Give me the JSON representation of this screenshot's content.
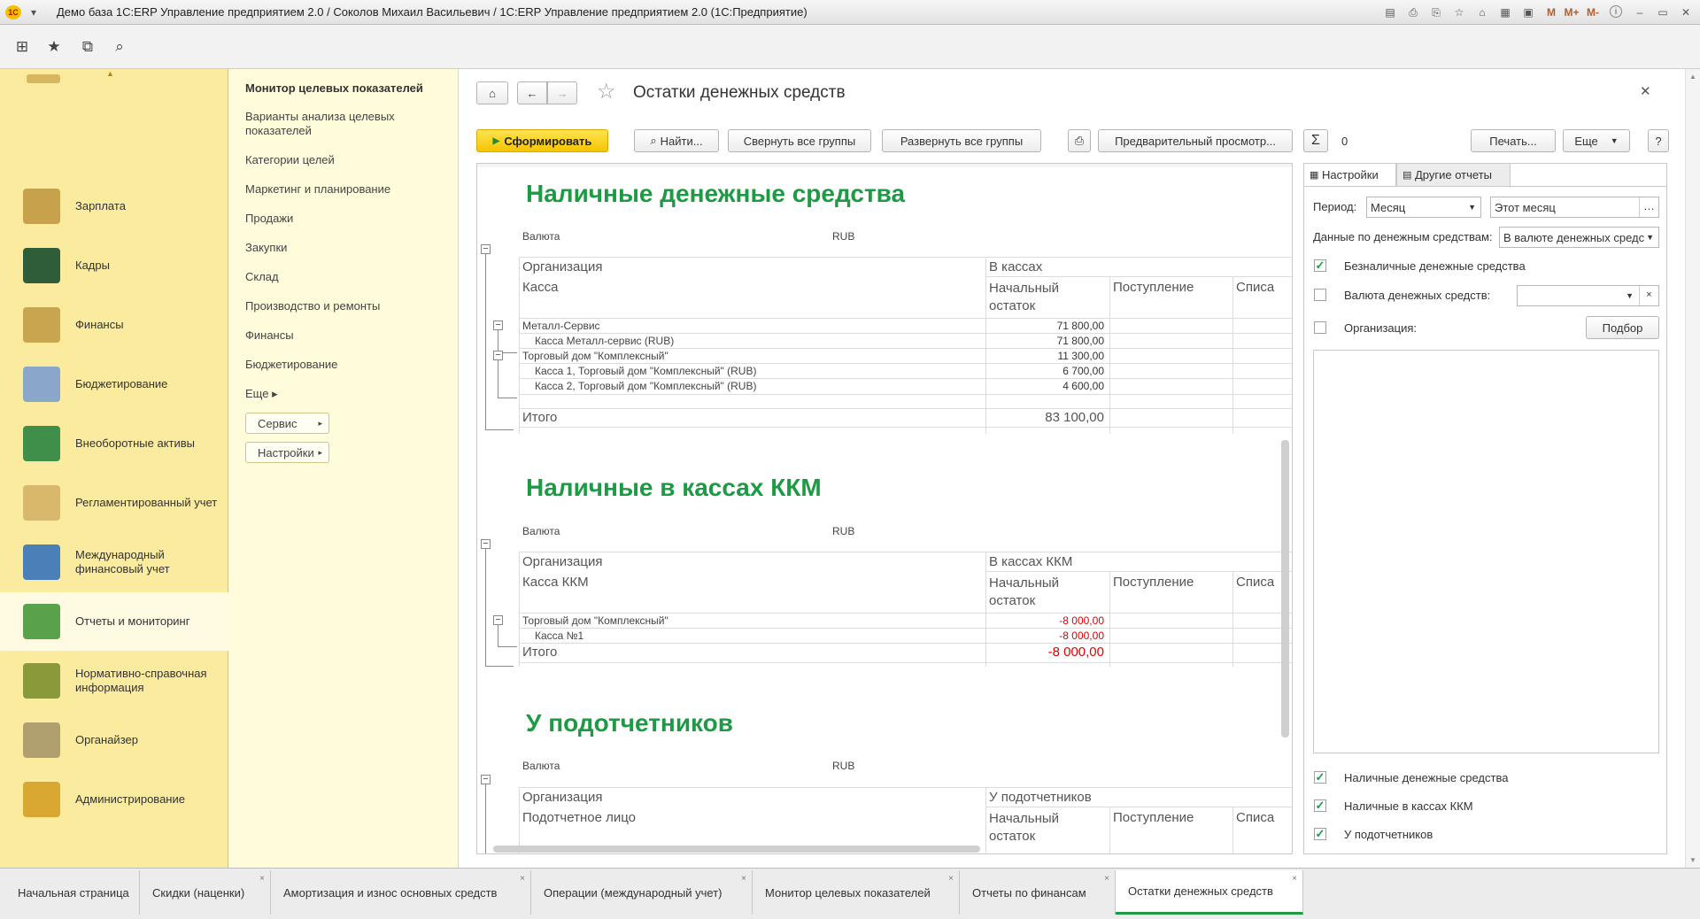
{
  "window": {
    "title": "Демо база 1С:ERP Управление предприятием 2.0 / Соколов Михаил Васильевич / 1С:ERP Управление предприятием 2.0  (1С:Предприятие)",
    "logo": "1С"
  },
  "title_icons": [
    "M",
    "M+",
    "M-",
    "i"
  ],
  "sections": [
    {
      "label": "Зарплата",
      "icon": "payroll-icon",
      "color": "#c8a24a"
    },
    {
      "label": "Кадры",
      "icon": "personnel-icon",
      "color": "#2f5d3a"
    },
    {
      "label": "Финансы",
      "icon": "finance-icon",
      "color": "#c9a54e"
    },
    {
      "label": "Бюджетирование",
      "icon": "budget-icon",
      "color": "#8aa6c8"
    },
    {
      "label": "Внеоборотные активы",
      "icon": "assets-icon",
      "color": "#3f8f4a"
    },
    {
      "label": "Регламентированный учет",
      "icon": "regulated-icon",
      "color": "#d8b86a"
    },
    {
      "label": "Международный финансовый учет",
      "icon": "ifrs-icon",
      "color": "#4a7fb8"
    },
    {
      "label": "Отчеты и мониторинг",
      "icon": "reports-icon",
      "color": "#5aa24a"
    },
    {
      "label": "Нормативно-справочная информация",
      "icon": "reference-icon",
      "color": "#8a9a3a"
    },
    {
      "label": "Органайзер",
      "icon": "organizer-icon",
      "color": "#b0a070"
    },
    {
      "label": "Администрирование",
      "icon": "admin-icon",
      "color": "#d8a830"
    }
  ],
  "nav": {
    "header": "Монитор целевых показателей",
    "items": [
      "Варианты анализа целевых показателей",
      "Категории целей",
      "Маркетинг и планирование",
      "Продажи",
      "Закупки",
      "Склад",
      "Производство и ремонты",
      "Финансы",
      "Бюджетирование"
    ],
    "more": "Еще ▸",
    "service_button": "Сервис",
    "settings_button": "Настройки"
  },
  "form": {
    "title": "Остатки денежных средств",
    "generate_button": "Сформировать",
    "find_button": "Найти...",
    "collapse_button": "Свернуть все группы",
    "expand_button": "Развернуть все группы",
    "preview_button": "Предварительный просмотр...",
    "sum_value": "0",
    "print_button": "Печать...",
    "more_button": "Еще",
    "help_button": "?"
  },
  "report": {
    "sections": [
      {
        "title": "Наличные денежные средства",
        "currency_label": "Валюта",
        "currency": "RUB",
        "col_org": "Организация",
        "col_group": "В кассах",
        "col_sub": "Касса",
        "col_start": "Начальный остаток",
        "col_in": "Поступление",
        "col_out": "Списа",
        "rows": [
          {
            "name": "Металл-Сервис",
            "value": "71 800,00"
          },
          {
            "name": "Касса Металл-сервис (RUB)",
            "value": "71 800,00"
          },
          {
            "name": "Торговый дом \"Комплексный\"",
            "value": "11 300,00"
          },
          {
            "name": "Касса 1, Торговый дом \"Комплексный\" (RUB)",
            "value": "6 700,00"
          },
          {
            "name": "Касса 2, Торговый дом \"Комплексный\" (RUB)",
            "value": "4 600,00"
          }
        ],
        "total_label": "Итого",
        "total": "83 100,00"
      },
      {
        "title": "Наличные в кассах ККМ",
        "currency_label": "Валюта",
        "currency": "RUB",
        "col_org": "Организация",
        "col_group": "В кассах ККМ",
        "col_sub": "Касса ККМ",
        "col_start": "Начальный остаток",
        "col_in": "Поступление",
        "col_out": "Списа",
        "rows": [
          {
            "name": "Торговый дом \"Комплексный\"",
            "value": "-8 000,00"
          },
          {
            "name": "Касса №1",
            "value": "-8 000,00"
          }
        ],
        "total_label": "Итого",
        "total": "-8 000,00"
      },
      {
        "title": "У подотчетников",
        "currency_label": "Валюта",
        "currency": "RUB",
        "col_org": "Организация",
        "col_group": "У подотчетников",
        "col_sub": "Подотчетное лицо",
        "col_start": "Начальный остаток",
        "col_in": "Поступление",
        "col_out": "Списа"
      }
    ]
  },
  "settings": {
    "tab_settings": "Настройки",
    "tab_other": "Другие отчеты",
    "period_label": "Период:",
    "period_value": "Месяц",
    "period_range": "Этот месяц",
    "data_label": "Данные по денежным средствам:",
    "data_value": "В валюте денежных средс",
    "cb_noncash": "Безналичные денежные средства",
    "cb_currency": "Валюта денежных средств:",
    "cb_org": "Организация:",
    "pick_button": "Подбор",
    "cb_cash": "Наличные денежные средства",
    "cb_kkm": "Наличные в кассах ККМ",
    "cb_accountable": "У подотчетников"
  },
  "open_tabs": [
    {
      "label": "Начальная страница"
    },
    {
      "label": "Скидки (наценки)"
    },
    {
      "label": "Амортизация и износ основных средств"
    },
    {
      "label": "Операции (международный учет)"
    },
    {
      "label": "Монитор целевых показателей"
    },
    {
      "label": "Отчеты по финансам"
    },
    {
      "label": "Остатки денежных средств"
    }
  ]
}
